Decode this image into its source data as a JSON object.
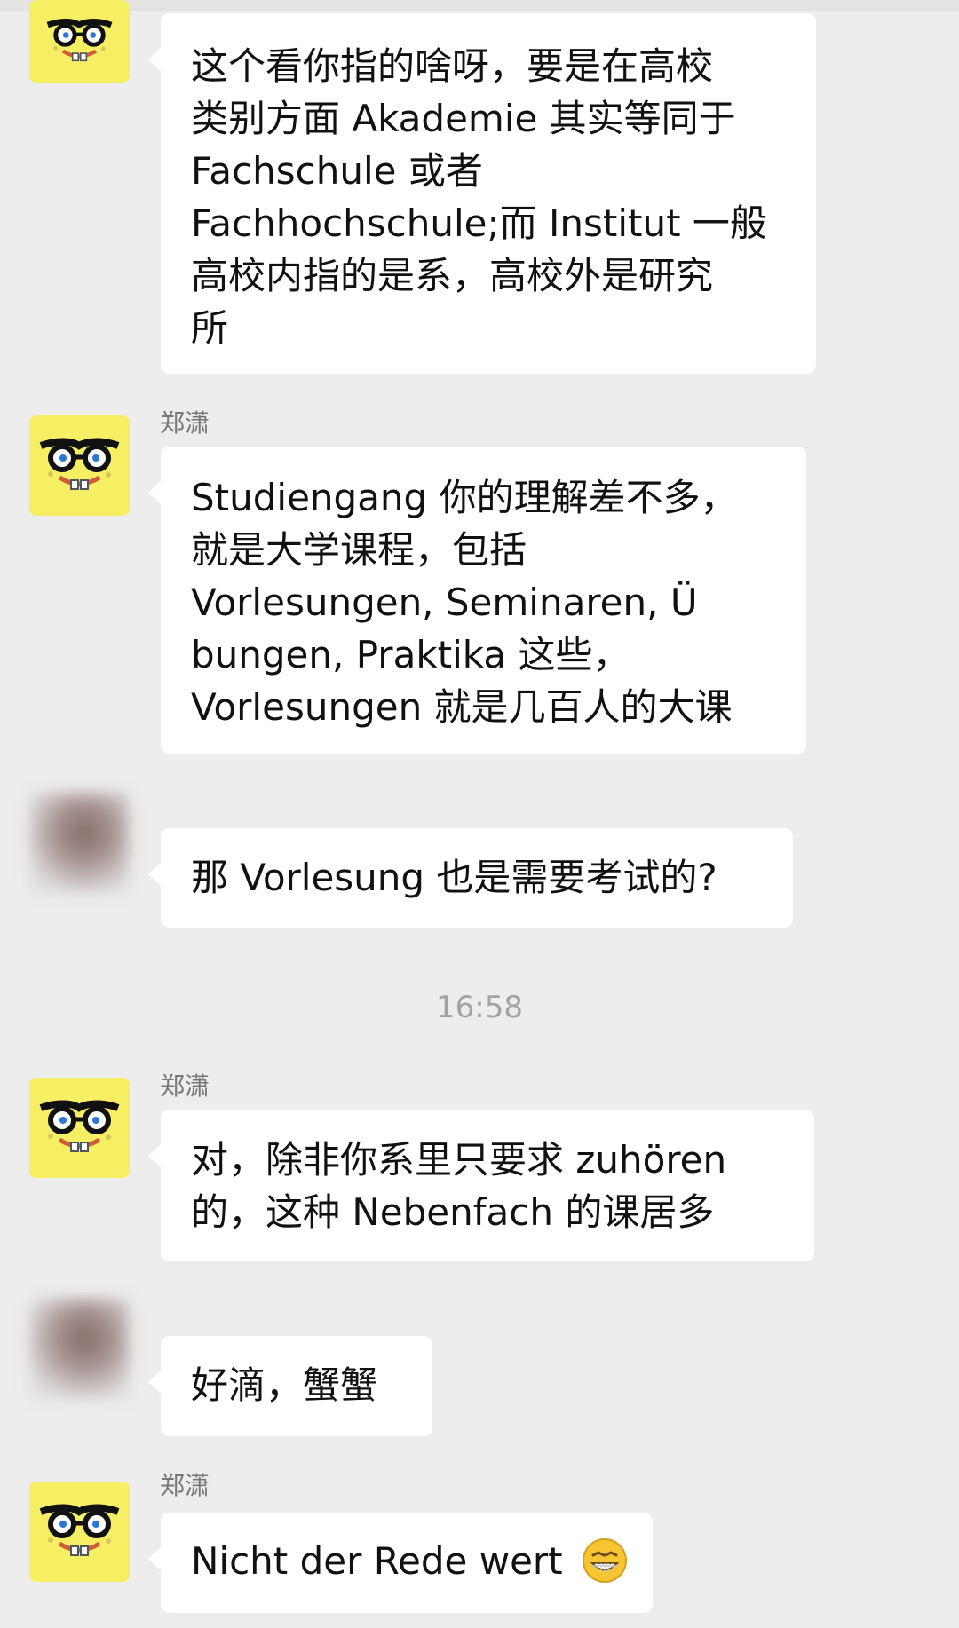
{
  "chat": {
    "messages": [
      {
        "sender": "",
        "lines": [
          "这个看你指的啥呀，要是在高校",
          "类别方面 Akademie 其实等同于",
          "Fachschule 或者",
          "Fachhochschule;而 Institut 一般",
          "高校内指的是系，高校外是研究",
          "所"
        ]
      },
      {
        "sender": "郑潇",
        "lines": [
          "Studiengang 你的理解差不多，",
          "就是大学课程，包括",
          "Vorlesungen, Seminaren, Ü",
          "bungen, Praktika 这些，",
          "Vorlesungen 就是几百人的大课"
        ]
      },
      {
        "sender": "",
        "lines": [
          "那 Vorlesung 也是需要考试的?"
        ]
      },
      {
        "sender": "郑潇",
        "lines": [
          "对，除非你系里只要求 zuhören",
          "的，这种 Nebenfach 的课居多"
        ]
      },
      {
        "sender": "",
        "lines": [
          "好滴，蟹蟹"
        ]
      },
      {
        "sender": "郑潇",
        "lines": [
          "Nicht der Rede wert"
        ],
        "emoji": "grinning-face-emoji"
      }
    ],
    "timestamp": "16:58"
  },
  "colors": {
    "background": "#ededed",
    "bubble": "#ffffff",
    "avatar_sponge": "#f7ef63",
    "name_text": "#777777",
    "timestamp_text": "#a3a3a3"
  },
  "icons": {
    "sponge_avatar": "spongebob-avatar-icon",
    "blurred_avatar": "blurred-user-avatar",
    "emoji": "grinning-face-emoji"
  }
}
